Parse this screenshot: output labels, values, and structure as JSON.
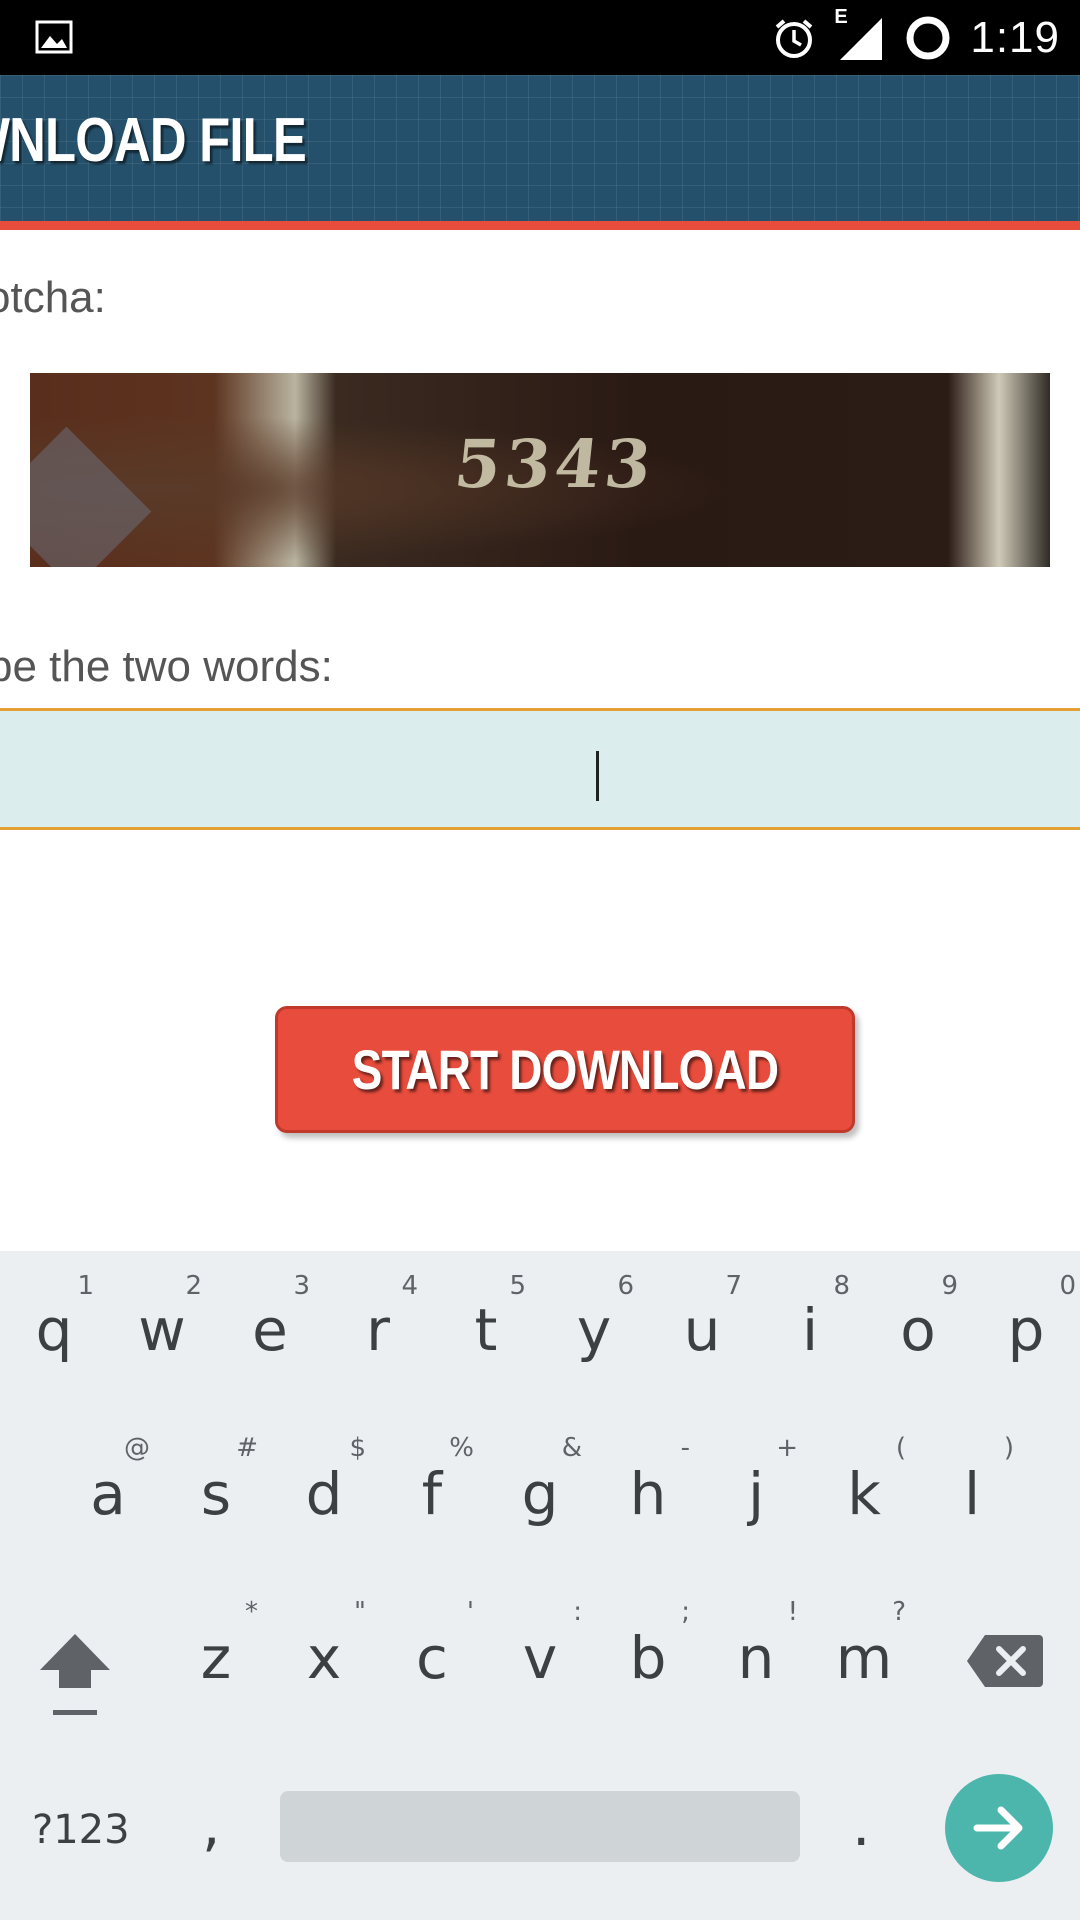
{
  "status_bar": {
    "time": "1:19",
    "network_type": "E",
    "icons": [
      "image-icon",
      "alarm-icon",
      "signal-icon",
      "sync-icon"
    ]
  },
  "header": {
    "title": "WNLOAD FILE",
    "background_color": "#24506b",
    "accent_color": "#e74c3c"
  },
  "captcha": {
    "label": "otcha:",
    "image_text": "5343"
  },
  "words": {
    "label": "pe the two words:",
    "value": ""
  },
  "start_button": {
    "label": "START DOWNLOAD",
    "color": "#e74c3c"
  },
  "keyboard": {
    "row1": [
      {
        "key": "q",
        "hint": "1"
      },
      {
        "key": "w",
        "hint": "2"
      },
      {
        "key": "e",
        "hint": "3"
      },
      {
        "key": "r",
        "hint": "4"
      },
      {
        "key": "t",
        "hint": "5"
      },
      {
        "key": "y",
        "hint": "6"
      },
      {
        "key": "u",
        "hint": "7"
      },
      {
        "key": "i",
        "hint": "8"
      },
      {
        "key": "o",
        "hint": "9"
      },
      {
        "key": "p",
        "hint": "0"
      }
    ],
    "row2": [
      {
        "key": "a",
        "hint": "@"
      },
      {
        "key": "s",
        "hint": "#"
      },
      {
        "key": "d",
        "hint": "$"
      },
      {
        "key": "f",
        "hint": "%"
      },
      {
        "key": "g",
        "hint": "&"
      },
      {
        "key": "h",
        "hint": "-"
      },
      {
        "key": "j",
        "hint": "+"
      },
      {
        "key": "k",
        "hint": "("
      },
      {
        "key": "l",
        "hint": ")"
      }
    ],
    "row3": [
      {
        "key": "z",
        "hint": "*"
      },
      {
        "key": "x",
        "hint": "\""
      },
      {
        "key": "c",
        "hint": "'"
      },
      {
        "key": "v",
        "hint": ":"
      },
      {
        "key": "b",
        "hint": ";"
      },
      {
        "key": "n",
        "hint": "!"
      },
      {
        "key": "m",
        "hint": "?"
      }
    ],
    "symbols_label": "?123",
    "comma": ",",
    "period": ".",
    "enter_color": "#4db6ac"
  }
}
